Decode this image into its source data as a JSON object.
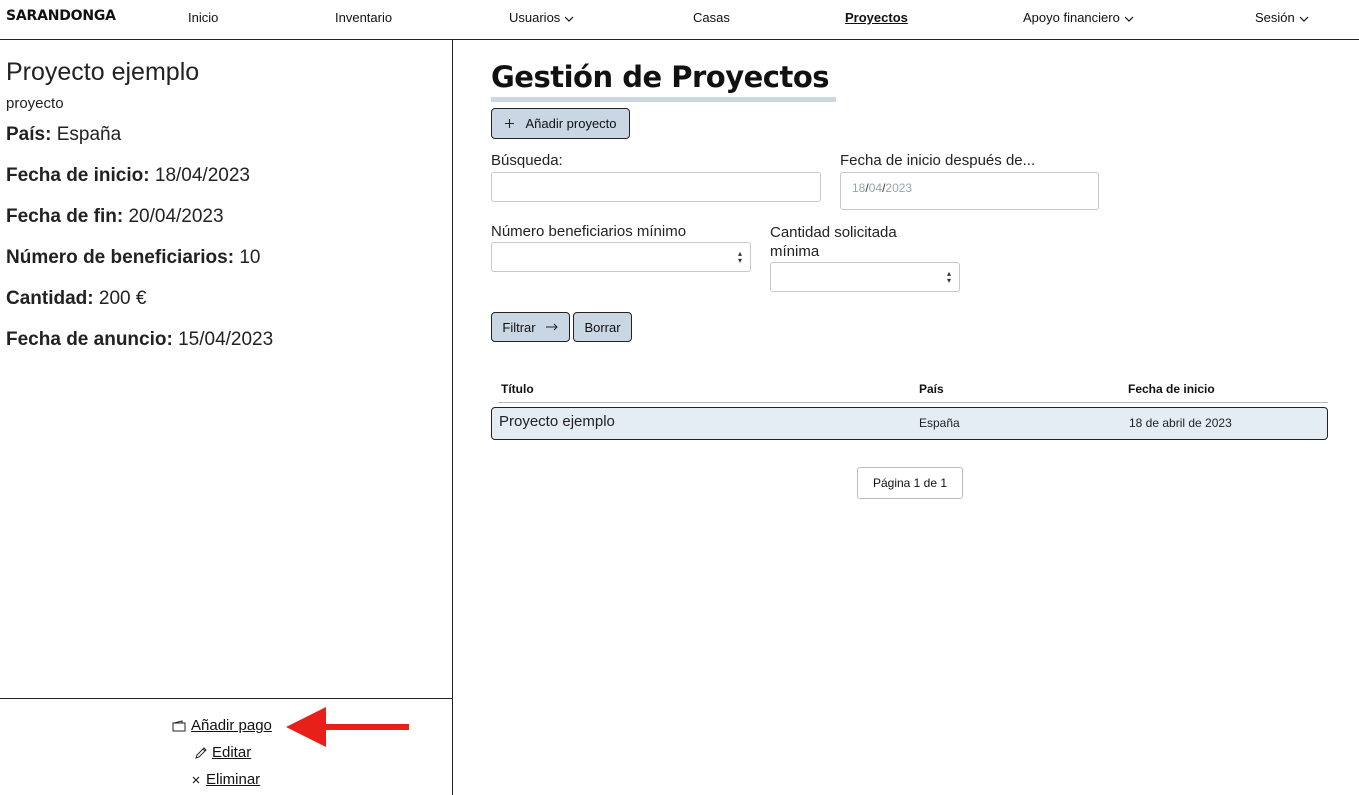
{
  "nav": {
    "logo": "SARANDONGA",
    "items": [
      {
        "label": "Inicio"
      },
      {
        "label": "Inventario"
      },
      {
        "label": "Usuarios"
      },
      {
        "label": "Casas"
      },
      {
        "label": "Proyectos"
      },
      {
        "label": "Apoyo financiero"
      },
      {
        "label": "Sesión"
      }
    ]
  },
  "detail": {
    "title": "Proyecto ejemplo",
    "subtitle": "proyecto",
    "fields": [
      {
        "label": "País:",
        "value": "España"
      },
      {
        "label": "Fecha de inicio:",
        "value": "18/04/2023"
      },
      {
        "label": "Fecha de fin:",
        "value": "20/04/2023"
      },
      {
        "label": "Número de beneficiarios:",
        "value": "10"
      },
      {
        "label": "Cantidad:",
        "value": "200 €"
      },
      {
        "label": "Fecha de anuncio:",
        "value": "15/04/2023"
      }
    ],
    "actions": {
      "add_payment": "Añadir pago",
      "edit": "Editar",
      "delete": "Eliminar"
    }
  },
  "main": {
    "title": "Gestión de Proyectos",
    "add_button": "Añadir proyecto",
    "filters": {
      "search_label": "Búsqueda:",
      "search_value": "",
      "date_label": "Fecha de inicio después de...",
      "date_day": "18",
      "date_month": "04",
      "date_year": "2023",
      "beneficiaries_label": "Número beneficiarios mínimo",
      "amount_label_line1": "Cantidad solicitada",
      "amount_label_line2": "mínima",
      "filter_button": "Filtrar",
      "clear_button": "Borrar"
    },
    "table": {
      "headers": [
        "Título",
        "País",
        "Fecha de inicio"
      ],
      "rows": [
        {
          "title": "Proyecto ejemplo",
          "country": "España",
          "start": "18 de abril de 2023"
        }
      ]
    },
    "pagination": "Página 1 de 1"
  },
  "colors": {
    "button_bg": "#c9d6e4",
    "row_bg": "#e4ecf4",
    "annotation_arrow": "#e8201a"
  }
}
